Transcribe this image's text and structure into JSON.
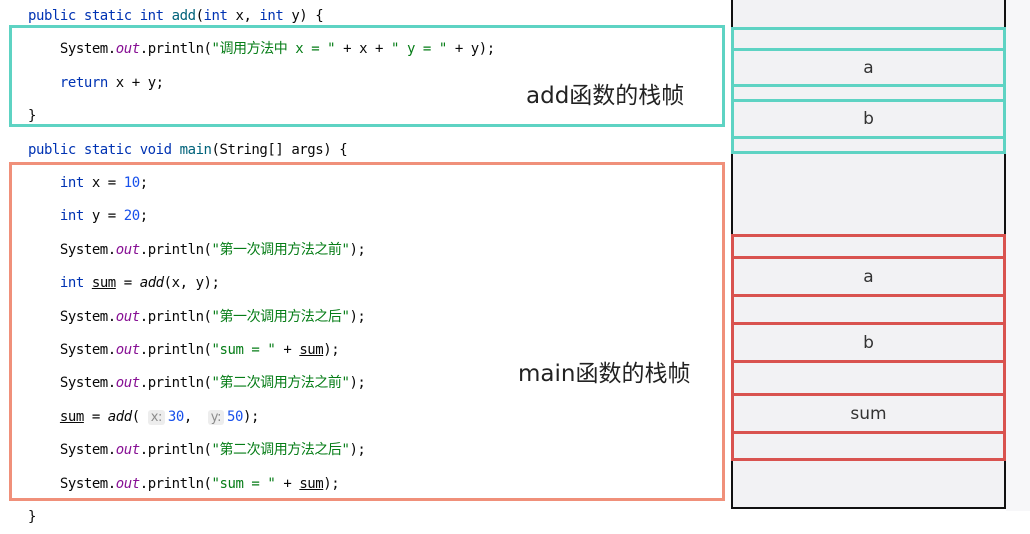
{
  "code": {
    "lines": [
      [
        [
          "public static int ",
          "kw"
        ],
        [
          "add",
          "fn"
        ],
        [
          "(",
          ""
        ],
        [
          "int ",
          "kw"
        ],
        [
          "x, ",
          ""
        ],
        [
          "int ",
          "kw"
        ],
        [
          "y) {",
          ""
        ]
      ],
      [
        [
          "    System.",
          ""
        ],
        [
          "out",
          "field"
        ],
        [
          ".println(",
          ""
        ],
        [
          "\"调用方法中 x = \"",
          "str"
        ],
        [
          " + x + ",
          ""
        ],
        [
          "\" y = \"",
          "str"
        ],
        [
          " + y);",
          ""
        ]
      ],
      [
        [
          "    ",
          ""
        ],
        [
          "return ",
          "kw"
        ],
        [
          "x + y;",
          ""
        ]
      ],
      [
        [
          "}",
          ""
        ]
      ],
      [
        [
          "public static void ",
          "kw"
        ],
        [
          "main",
          "fn"
        ],
        [
          "(String[] args) {",
          ""
        ]
      ],
      [
        [
          "    ",
          ""
        ],
        [
          "int ",
          "kw"
        ],
        [
          "x = ",
          ""
        ],
        [
          "10",
          "num"
        ],
        [
          ";",
          ""
        ]
      ],
      [
        [
          "    ",
          ""
        ],
        [
          "int ",
          "kw"
        ],
        [
          "y = ",
          ""
        ],
        [
          "20",
          "num"
        ],
        [
          ";",
          ""
        ]
      ],
      [
        [
          "    System.",
          ""
        ],
        [
          "out",
          "field"
        ],
        [
          ".println(",
          ""
        ],
        [
          "\"第一次调用方法之前\"",
          "str"
        ],
        [
          ");",
          ""
        ]
      ],
      [
        [
          "    ",
          ""
        ],
        [
          "int ",
          "kw"
        ],
        [
          "sum",
          "ul"
        ],
        [
          " = ",
          ""
        ],
        [
          "add",
          "it"
        ],
        [
          "(x, y);",
          ""
        ]
      ],
      [
        [
          "    System.",
          ""
        ],
        [
          "out",
          "field"
        ],
        [
          ".println(",
          ""
        ],
        [
          "\"第一次调用方法之后\"",
          "str"
        ],
        [
          ");",
          ""
        ]
      ],
      [
        [
          "    System.",
          ""
        ],
        [
          "out",
          "field"
        ],
        [
          ".println(",
          ""
        ],
        [
          "\"sum = \"",
          "str"
        ],
        [
          " + ",
          ""
        ],
        [
          "sum",
          "ul"
        ],
        [
          ");",
          ""
        ]
      ],
      [
        [
          "    System.",
          ""
        ],
        [
          "out",
          "field"
        ],
        [
          ".println(",
          ""
        ],
        [
          "\"第二次调用方法之前\"",
          "str"
        ],
        [
          ");",
          ""
        ]
      ],
      [
        [
          "    ",
          ""
        ],
        [
          "sum",
          "ul"
        ],
        [
          " = ",
          ""
        ],
        [
          "add",
          "it"
        ],
        [
          "( ",
          ""
        ],
        [
          "x:",
          "hint"
        ],
        [
          "30",
          "num"
        ],
        [
          ",  ",
          ""
        ],
        [
          "y:",
          "hint"
        ],
        [
          "50",
          "num"
        ],
        [
          ");",
          ""
        ]
      ],
      [
        [
          "    System.",
          ""
        ],
        [
          "out",
          "field"
        ],
        [
          ".println(",
          ""
        ],
        [
          "\"第二次调用方法之后\"",
          "str"
        ],
        [
          ");",
          ""
        ]
      ],
      [
        [
          "    System.",
          ""
        ],
        [
          "out",
          "field"
        ],
        [
          ".println(",
          ""
        ],
        [
          "\"sum = \"",
          "str"
        ],
        [
          " + ",
          ""
        ],
        [
          "sum",
          "ul"
        ],
        [
          ");",
          ""
        ]
      ],
      [
        [
          "}",
          ""
        ]
      ]
    ]
  },
  "frames": {
    "add_label": "add函数的栈帧",
    "main_label": "main函数的栈帧",
    "add_color": "#5ed3c3",
    "main_color": "#f0907a"
  },
  "stack": {
    "add_cells": [
      "",
      "a",
      "",
      "b",
      ""
    ],
    "main_cells": [
      "",
      "a",
      "",
      "b",
      "",
      "sum",
      ""
    ],
    "add_cell_color": "#5ed3c3",
    "main_cell_color": "#d9534f"
  }
}
